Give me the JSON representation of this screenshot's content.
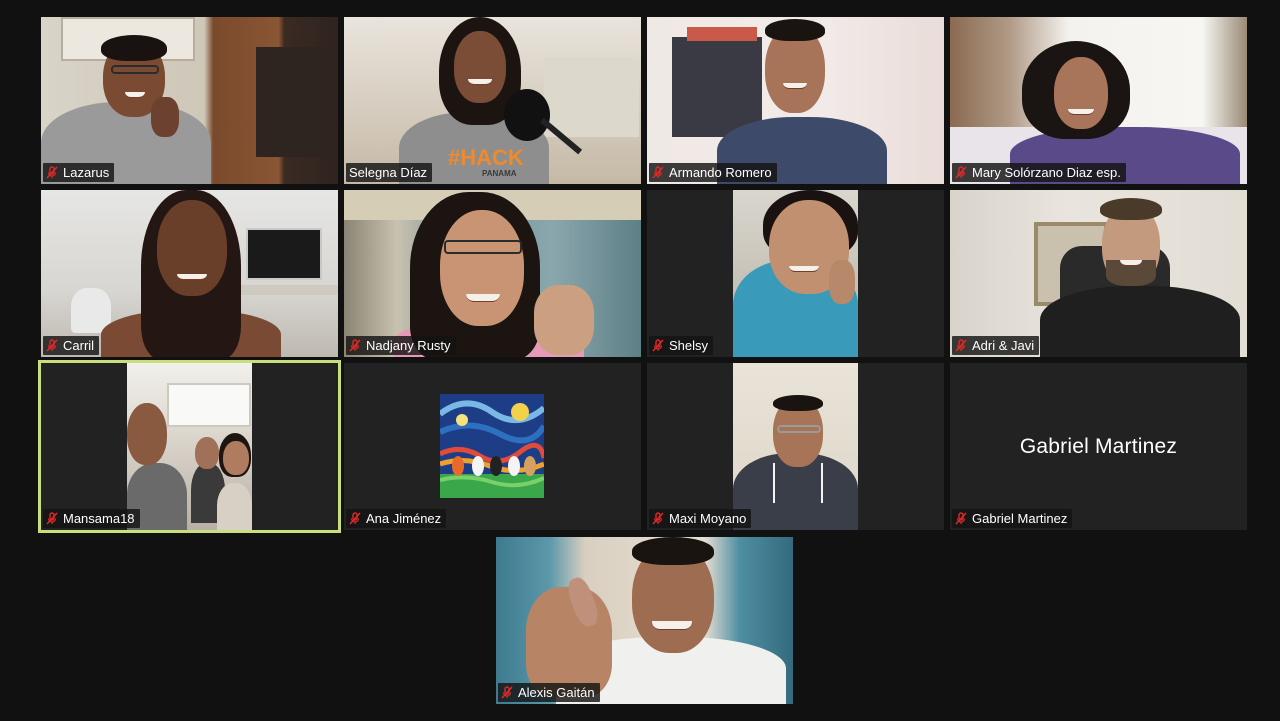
{
  "meeting": {
    "view": "gallery",
    "colors": {
      "background": "#111111",
      "tile_background": "#222222",
      "active_speaker_border": "#c9df7f",
      "muted_mic_icon": "#e02828",
      "name_tag_text": "#ffffff"
    }
  },
  "participants": [
    {
      "name": "Lazarus",
      "muted": true,
      "video": true
    },
    {
      "name": "Selegna Díaz",
      "muted": false,
      "video": true,
      "shirt_text": "#HACK",
      "shirt_subtext": "PANAMA"
    },
    {
      "name": "Armando Romero",
      "muted": true,
      "video": true
    },
    {
      "name": "Mary Solórzano Diaz esp.",
      "muted": true,
      "video": true
    },
    {
      "name": "Carril",
      "muted": true,
      "video": true
    },
    {
      "name": "Nadjany Rusty",
      "muted": true,
      "video": true
    },
    {
      "name": "Shelsy",
      "muted": true,
      "video": true
    },
    {
      "name": "Adri & Javi",
      "muted": true,
      "video": true
    },
    {
      "name": "Mansama18",
      "muted": true,
      "video": true,
      "active_speaker": true
    },
    {
      "name": "Ana Jiménez",
      "muted": true,
      "video": false,
      "avatar": "painting"
    },
    {
      "name": "Maxi Moyano",
      "muted": true,
      "video": true
    },
    {
      "name": "Gabriel Martinez",
      "muted": true,
      "video": false,
      "display_name": "Gabriel Martinez"
    },
    {
      "name": "Alexis Gaitán",
      "muted": true,
      "video": true
    }
  ]
}
